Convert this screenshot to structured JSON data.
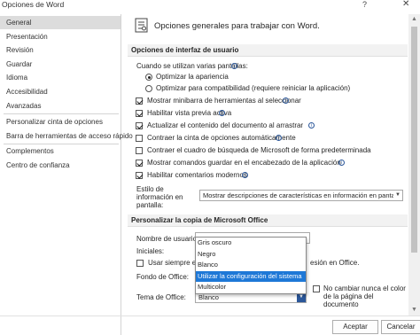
{
  "window": {
    "title": "Opciones de Word",
    "help": "?",
    "close": "✕"
  },
  "sidebar": {
    "items": [
      {
        "label": "General"
      },
      {
        "label": "Presentación"
      },
      {
        "label": "Revisión"
      },
      {
        "label": "Guardar"
      },
      {
        "label": "Idioma"
      },
      {
        "label": "Accesibilidad"
      },
      {
        "label": "Avanzadas"
      },
      {
        "label": "Personalizar cinta de opciones"
      },
      {
        "label": "Barra de herramientas de acceso rápido"
      },
      {
        "label": "Complementos"
      },
      {
        "label": "Centro de confianza"
      }
    ]
  },
  "header": {
    "title": "Opciones generales para trabajar con Word."
  },
  "ui_options": {
    "section_title": "Opciones de interfaz de usuario",
    "multi_screen_label": "Cuando se utilizan varias pantallas:",
    "radio_optimize_appearance": "Optimizar la apariencia",
    "radio_optimize_compat": "Optimizar para compatibilidad (requiere reiniciar la aplicación)",
    "cb_mini_toolbar": "Mostrar minibarra de herramientas al seleccionar",
    "cb_live_preview": "Habilitar vista previa activa",
    "cb_update_drag": "Actualizar el contenido del documento al arrastrar",
    "cb_collapse_ribbon": "Contraer la cinta de opciones automáticamente",
    "cb_collapse_search": "Contraer el cuadro de búsqueda de Microsoft de forma predeterminada",
    "cb_show_save": "Mostrar comandos guardar en el encabezado de la aplicación",
    "cb_modern_comments": "Habilitar comentarios modernos",
    "screentip_label_1": "Estilo de",
    "screentip_label_2": "información en",
    "screentip_label_3": "pantalla:",
    "screentip_value": "Mostrar descripciones de características en información en pantalla"
  },
  "personalize": {
    "section_title": "Personalizar la copia de Microsoft Office",
    "username_label": "Nombre de usuario:",
    "initials_label": "Iniciales:",
    "always_use_label_left": "Usar siempre esto",
    "always_use_label_right": "esión en Office.",
    "background_label": "Fondo de Office:",
    "theme_label": "Tema de Office:",
    "theme_value": "Blanco",
    "never_change_1": "No cambiar nunca el color",
    "never_change_2": "de la página del",
    "never_change_3": "documento"
  },
  "theme_dropdown": {
    "options": [
      {
        "label": "Gris oscuro"
      },
      {
        "label": "Negro"
      },
      {
        "label": "Blanco"
      },
      {
        "label": "Utilizar la configuración del sistema"
      },
      {
        "label": "Multicolor"
      }
    ],
    "highlighted": "Utilizar la configuración del sistema"
  },
  "footer": {
    "accept_label": "Aceptar",
    "cancel_label": "Cancelar"
  },
  "colors": {
    "accent": "#2b579a",
    "highlight": "#1e78d7",
    "selected_nav": "#dcdcdc",
    "section_bg": "#f2f2f2"
  }
}
